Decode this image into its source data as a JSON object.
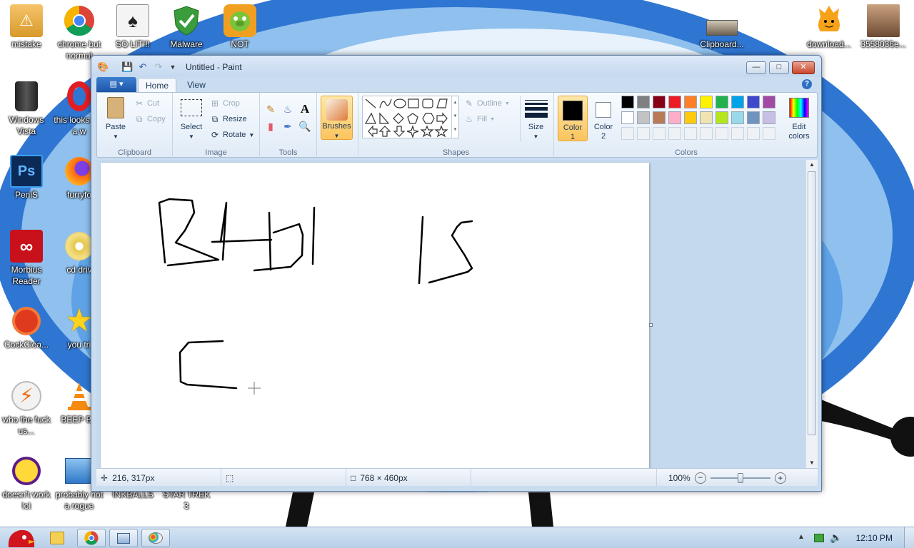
{
  "desktop": {
    "icons": [
      {
        "label": "mistake"
      },
      {
        "label": "chrome but normal"
      },
      {
        "label": "SO LIT!!!"
      },
      {
        "label": "Malware"
      },
      {
        "label": "NOT"
      },
      {
        "label": "Clipboard..."
      },
      {
        "label": "download..."
      },
      {
        "label": "3558036e..."
      },
      {
        "label": "Windows Vista"
      },
      {
        "label": "this looks like a w"
      },
      {
        "label": "PeniS"
      },
      {
        "label": "furryfo"
      },
      {
        "label": "Morbius Reader"
      },
      {
        "label": "cd driv"
      },
      {
        "label": "CockClea..."
      },
      {
        "label": "you tri"
      },
      {
        "label": "who the fuck us..."
      },
      {
        "label": "BEEP BE"
      },
      {
        "label": "doesn't work lol"
      },
      {
        "label": "probably not a rogue"
      },
      {
        "label": "INKBALLS"
      },
      {
        "label": "STAR TREK 3"
      }
    ]
  },
  "window": {
    "title": "Untitled - Paint",
    "tabs": {
      "home": "Home",
      "view": "View"
    },
    "help": "?"
  },
  "ribbon": {
    "clipboard": {
      "group": "Clipboard",
      "paste": "Paste",
      "cut": "Cut",
      "copy": "Copy"
    },
    "image": {
      "group": "Image",
      "select": "Select",
      "crop": "Crop",
      "resize": "Resize",
      "rotate": "Rotate"
    },
    "tools": {
      "group": "Tools"
    },
    "brushes": {
      "label": "Brushes"
    },
    "shapes": {
      "group": "Shapes",
      "outline": "Outline",
      "fill": "Fill"
    },
    "size": {
      "label": "Size"
    },
    "colors": {
      "group": "Colors",
      "color1_label": "Color",
      "color1_num": "1",
      "color2_label": "Color",
      "color2_num": "2",
      "edit_colors": "Edit colors",
      "color1_value": "#000000",
      "color2_value": "#ffffff",
      "palette_row1": [
        "#000000",
        "#7f7f7f",
        "#880015",
        "#ed1c24",
        "#ff7f27",
        "#fff200",
        "#22b14c",
        "#00a2e8",
        "#3f48cc",
        "#a349a4"
      ],
      "palette_row2": [
        "#ffffff",
        "#c3c3c3",
        "#b97a57",
        "#ffaec9",
        "#ffc90e",
        "#efe4b0",
        "#b5e61d",
        "#99d9ea",
        "#7092be",
        "#c8bfe7"
      ]
    }
  },
  "statusbar": {
    "cursor_pos": "216, 317px",
    "canvas_size": "768 × 460px",
    "zoom": "100%"
  },
  "taskbar": {
    "clock": "12:10 PM"
  }
}
